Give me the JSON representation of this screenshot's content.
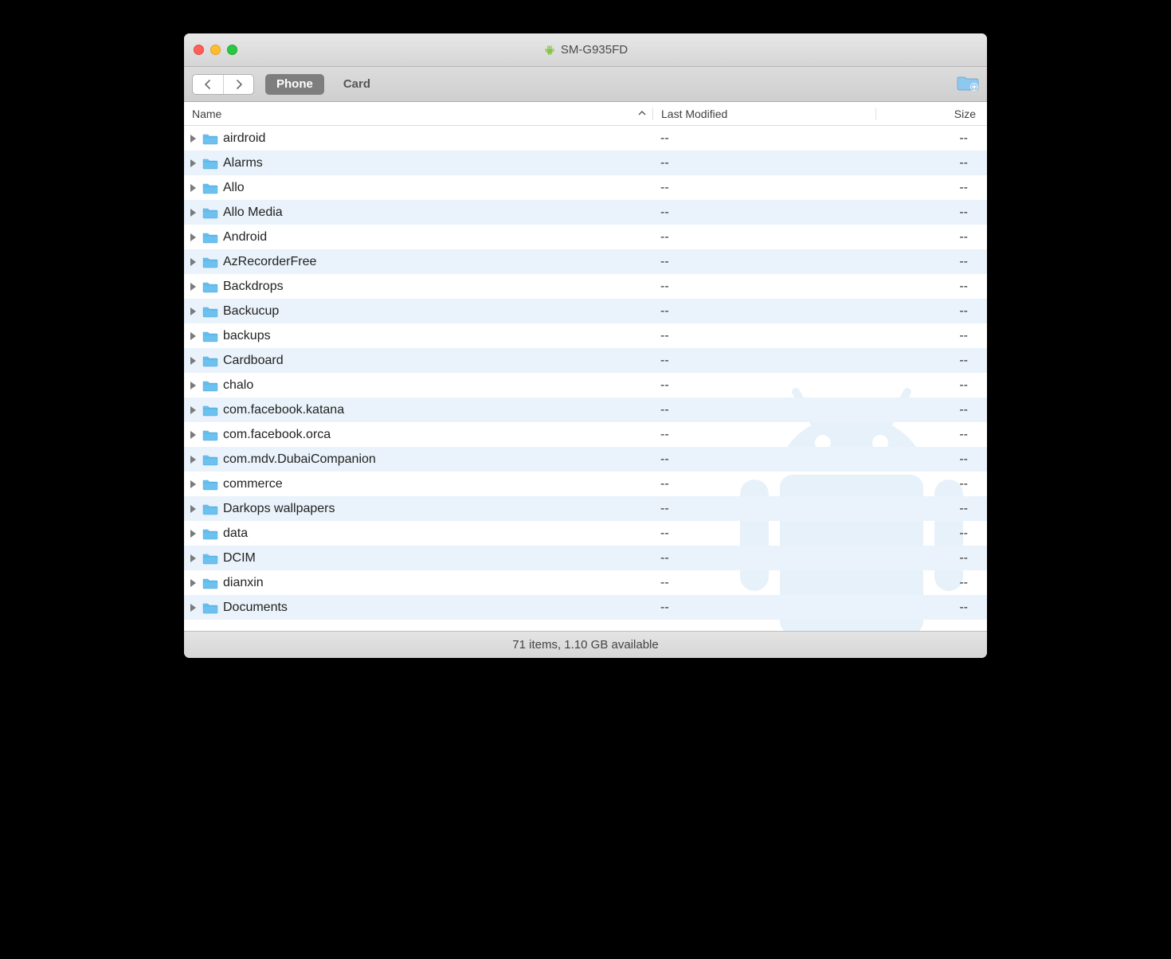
{
  "window": {
    "title": "SM-G935FD"
  },
  "toolbar": {
    "tabs": [
      {
        "label": "Phone",
        "active": true
      },
      {
        "label": "Card",
        "active": false
      }
    ]
  },
  "columns": {
    "name": "Name",
    "modified": "Last Modified",
    "size": "Size",
    "sort_indicator": "⌃"
  },
  "rows": [
    {
      "name": "airdroid",
      "modified": "--",
      "size": "--"
    },
    {
      "name": "Alarms",
      "modified": "--",
      "size": "--"
    },
    {
      "name": "Allo",
      "modified": "--",
      "size": "--"
    },
    {
      "name": "Allo Media",
      "modified": "--",
      "size": "--"
    },
    {
      "name": "Android",
      "modified": "--",
      "size": "--"
    },
    {
      "name": "AzRecorderFree",
      "modified": "--",
      "size": "--"
    },
    {
      "name": "Backdrops",
      "modified": "--",
      "size": "--"
    },
    {
      "name": "Backucup",
      "modified": "--",
      "size": "--"
    },
    {
      "name": "backups",
      "modified": "--",
      "size": "--"
    },
    {
      "name": "Cardboard",
      "modified": "--",
      "size": "--"
    },
    {
      "name": "chalo",
      "modified": "--",
      "size": "--"
    },
    {
      "name": "com.facebook.katana",
      "modified": "--",
      "size": "--"
    },
    {
      "name": "com.facebook.orca",
      "modified": "--",
      "size": "--"
    },
    {
      "name": "com.mdv.DubaiCompanion",
      "modified": "--",
      "size": "--"
    },
    {
      "name": "commerce",
      "modified": "--",
      "size": "--"
    },
    {
      "name": "Darkops wallpapers",
      "modified": "--",
      "size": "--"
    },
    {
      "name": "data",
      "modified": "--",
      "size": "--"
    },
    {
      "name": "DCIM",
      "modified": "--",
      "size": "--"
    },
    {
      "name": "dianxin",
      "modified": "--",
      "size": "--"
    },
    {
      "name": "Documents",
      "modified": "--",
      "size": "--"
    }
  ],
  "status": {
    "text": "71 items, 1.10 GB available"
  }
}
